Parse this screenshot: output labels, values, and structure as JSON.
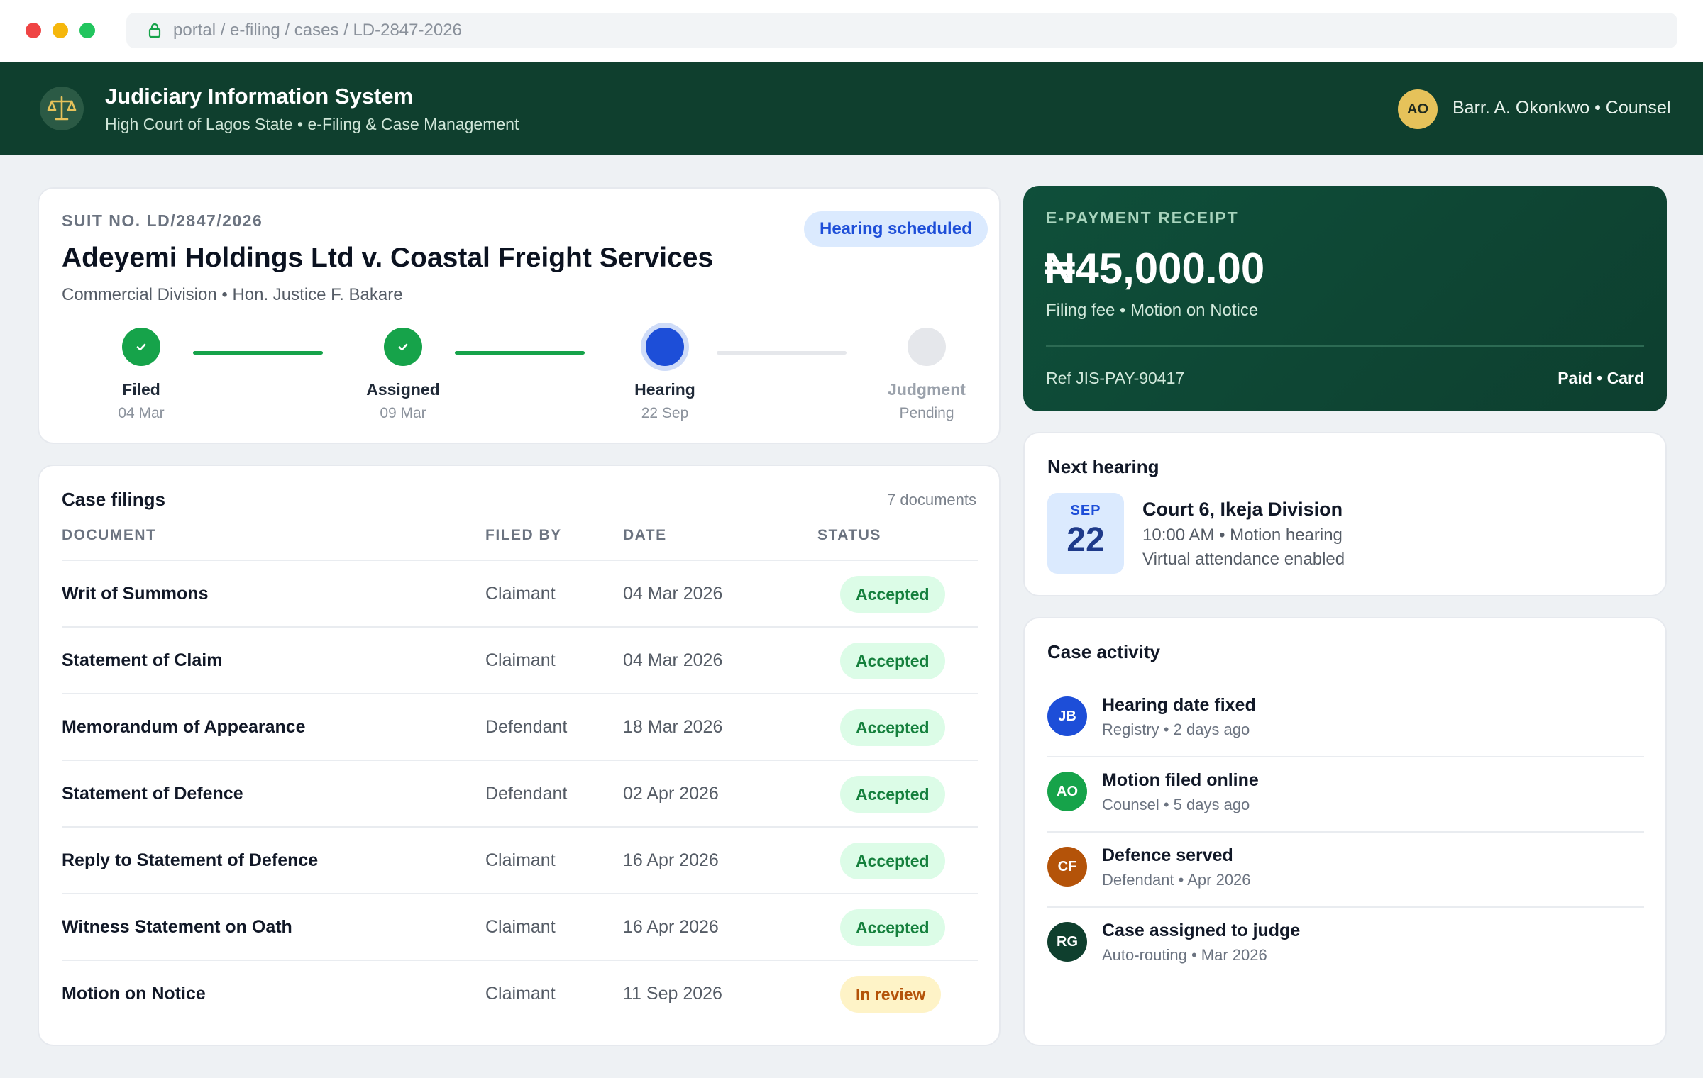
{
  "browser": {
    "url": "portal / e-filing / cases / LD-2847-2026"
  },
  "header": {
    "title": "Judiciary Information System",
    "subtitle": "High Court of Lagos State • e-Filing & Case Management",
    "user_initials": "AO",
    "user_label": "Barr. A. Okonkwo • Counsel"
  },
  "case": {
    "suit_no": "SUIT NO. LD/2847/2026",
    "title": "Adeyemi Holdings Ltd v. Coastal Freight Services",
    "meta": "Commercial Division • Hon. Justice F. Bakare",
    "status_badge": "Hearing scheduled",
    "steps": [
      {
        "label": "Filed",
        "date": "04 Mar",
        "state": "done"
      },
      {
        "label": "Assigned",
        "date": "09 Mar",
        "state": "done"
      },
      {
        "label": "Hearing",
        "date": "22 Sep",
        "state": "active"
      },
      {
        "label": "Judgment",
        "date": "Pending",
        "state": "pending"
      }
    ]
  },
  "filings": {
    "title": "Case filings",
    "count": "7 documents",
    "columns": [
      "DOCUMENT",
      "FILED BY",
      "DATE",
      "STATUS"
    ],
    "rows": [
      {
        "document": "Writ of Summons",
        "filed_by": "Claimant",
        "date": "04 Mar 2026",
        "status": "Accepted"
      },
      {
        "document": "Statement of Claim",
        "filed_by": "Claimant",
        "date": "04 Mar 2026",
        "status": "Accepted"
      },
      {
        "document": "Memorandum of Appearance",
        "filed_by": "Defendant",
        "date": "18 Mar 2026",
        "status": "Accepted"
      },
      {
        "document": "Statement of Defence",
        "filed_by": "Defendant",
        "date": "02 Apr 2026",
        "status": "Accepted"
      },
      {
        "document": "Reply to Statement of Defence",
        "filed_by": "Claimant",
        "date": "16 Apr 2026",
        "status": "Accepted"
      },
      {
        "document": "Witness Statement on Oath",
        "filed_by": "Claimant",
        "date": "16 Apr 2026",
        "status": "Accepted"
      },
      {
        "document": "Motion on Notice",
        "filed_by": "Claimant",
        "date": "11 Sep 2026",
        "status": "In review"
      }
    ]
  },
  "payment": {
    "label": "E-PAYMENT RECEIPT",
    "amount": "₦45,000.00",
    "description": "Filing fee • Motion on Notice",
    "reference": "Ref JIS-PAY-90417",
    "status": "Paid • Card"
  },
  "next_hearing": {
    "title": "Next hearing",
    "month": "SEP",
    "day": "22",
    "court": "Court 6, Ikeja Division",
    "time": "10:00 AM • Motion hearing",
    "note": "Virtual attendance enabled"
  },
  "activity": {
    "title": "Case activity",
    "items": [
      {
        "initials": "JB",
        "title": "Hearing date fixed",
        "meta": "Registry • 2 days ago",
        "color": "#1d4ed8"
      },
      {
        "initials": "AO",
        "title": "Motion filed online",
        "meta": "Counsel • 5 days ago",
        "color": "#16a34a"
      },
      {
        "initials": "CF",
        "title": "Defence served",
        "meta": "Defendant • Apr 2026",
        "color": "#b45309"
      },
      {
        "initials": "RG",
        "title": "Case assigned to judge",
        "meta": "Auto-routing • Mar 2026",
        "color": "#0f3f2e"
      }
    ]
  },
  "colors": {
    "brand_green": "#0f3f2e",
    "accent_blue": "#1d4ed8",
    "success": "#16a34a",
    "warning": "#b45309"
  }
}
